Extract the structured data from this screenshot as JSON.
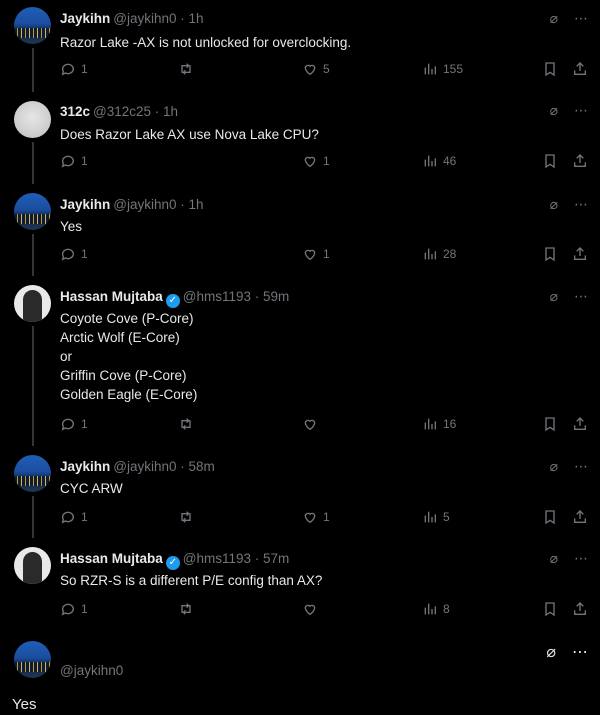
{
  "tweets": [
    {
      "name": "Jaykihn",
      "handle": "@jaykihn0 · 1h",
      "verified": false,
      "avatar": "city",
      "lines": [
        "Razor Lake -AX is not unlocked for overclocking."
      ],
      "replies": "1",
      "retweets": "",
      "likes": "5",
      "views": "155"
    },
    {
      "name": "312c",
      "handle": "@312c25 · 1h",
      "verified": false,
      "avatar": "gray",
      "lines": [
        "Does Razor Lake AX use Nova Lake CPU?"
      ],
      "replies": "1",
      "retweets": "",
      "likes": "1",
      "views": "46"
    },
    {
      "name": "Jaykihn",
      "handle": "@jaykihn0 · 1h",
      "verified": false,
      "avatar": "city",
      "lines": [
        "Yes"
      ],
      "replies": "1",
      "retweets": "",
      "likes": "1",
      "views": "28"
    },
    {
      "name": "Hassan Mujtaba",
      "handle": "@hms1193 · 59m",
      "verified": true,
      "avatar": "person",
      "lines": [
        "Coyote Cove (P-Core)",
        "Arctic Wolf (E-Core)",
        "or",
        "Griffin Cove (P-Core)",
        "Golden Eagle (E-Core)"
      ],
      "replies": "1",
      "retweets": "",
      "likes": "",
      "views": "16"
    },
    {
      "name": "Jaykihn",
      "handle": "@jaykihn0 · 58m",
      "verified": false,
      "avatar": "city",
      "lines": [
        "CYC ARW"
      ],
      "replies": "1",
      "retweets": "",
      "likes": "1",
      "views": "5"
    },
    {
      "name": "Hassan Mujtaba",
      "handle": "@hms1193 · 57m",
      "verified": true,
      "avatar": "person",
      "lines": [
        "So RZR-S is a different P/E config than AX?"
      ],
      "replies": "1",
      "retweets": "",
      "likes": "",
      "views": "8"
    }
  ],
  "final": {
    "handle": "@jaykihn0",
    "text": "Yes"
  },
  "icons": {
    "grok": "grok-icon",
    "more": "more-icon",
    "reply": "reply-icon",
    "retweet": "retweet-icon",
    "like": "like-icon",
    "views": "views-icon",
    "bookmark": "bookmark-icon",
    "share": "share-icon"
  },
  "colors": {
    "background": "#000000",
    "text": "#e7e9ea",
    "muted": "#71767b",
    "verified": "#1d9bf0"
  }
}
